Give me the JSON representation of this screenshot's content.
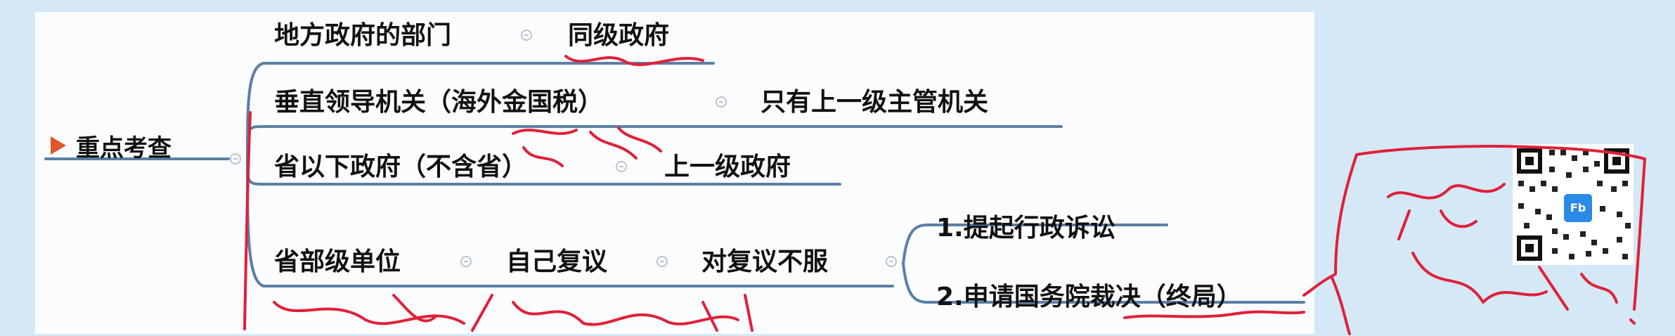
{
  "root": {
    "label": "重点考查"
  },
  "branches": [
    {
      "label": "地方政府的部门",
      "result": "同级政府"
    },
    {
      "label": "垂直领导机关（海外金国税）",
      "result": "只有上一级主管机关"
    },
    {
      "label": "省以下政府（不含省）",
      "result": "上一级政府"
    },
    {
      "label": "省部级单位",
      "step": "自己复议",
      "condition": "对复议不服",
      "options": [
        "1.提起行政诉讼",
        "2.申请国务院裁决（终局）"
      ]
    }
  ],
  "colors": {
    "background": "#d4e8f5",
    "canvas": "#fbfcfd",
    "line": "#5b7fa6",
    "ink": "#e0203a",
    "flag": "#e0552a"
  },
  "qr": {
    "badge": "Fb"
  }
}
